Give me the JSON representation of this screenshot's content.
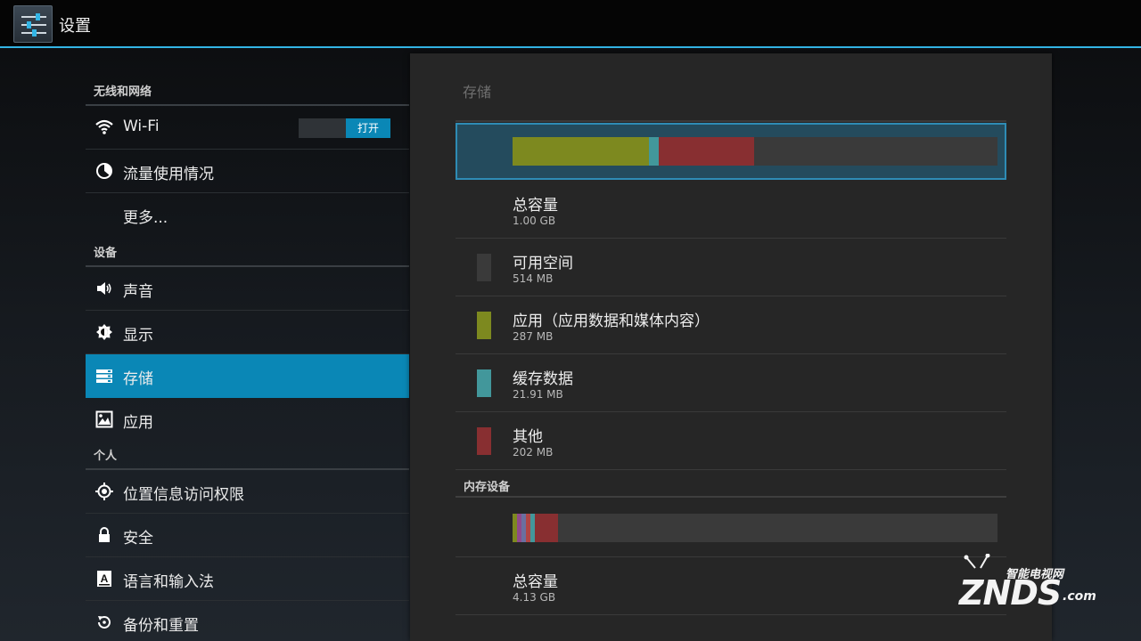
{
  "actionbar": {
    "title": "设置"
  },
  "sidebar": {
    "sections": [
      {
        "header": "无线和网络",
        "items": [
          {
            "label": "Wi-Fi",
            "icon": "wifi-icon",
            "toggle": "打开"
          },
          {
            "label": "流量使用情况",
            "icon": "data-usage-icon"
          },
          {
            "label": "更多..."
          }
        ]
      },
      {
        "header": "设备",
        "items": [
          {
            "label": "声音",
            "icon": "volume-icon"
          },
          {
            "label": "显示",
            "icon": "brightness-icon"
          },
          {
            "label": "存储",
            "icon": "storage-icon",
            "selected": true
          },
          {
            "label": "应用",
            "icon": "apps-icon"
          }
        ]
      },
      {
        "header": "个人",
        "items": [
          {
            "label": "位置信息访问权限",
            "icon": "location-icon"
          },
          {
            "label": "安全",
            "icon": "lock-icon"
          },
          {
            "label": "语言和输入法",
            "icon": "language-icon"
          },
          {
            "label": "备份和重置",
            "icon": "backup-icon"
          }
        ]
      }
    ]
  },
  "storage": {
    "title": "存储",
    "usage_bar": {
      "segments": [
        {
          "name": "应用",
          "fraction": 0.281,
          "color": "#7d891f"
        },
        {
          "name": "缓存数据",
          "fraction": 0.021,
          "color": "#42979b"
        },
        {
          "name": "其他",
          "fraction": 0.197,
          "color": "#882f31"
        }
      ],
      "track_color": "#3a3a3a"
    },
    "rows": [
      {
        "title": "总容量",
        "value": "1.00 GB",
        "color": null
      },
      {
        "title": "可用空间",
        "value": "514 MB",
        "color": "#3a3a3a"
      },
      {
        "title": "应用（应用数据和媒体内容）",
        "value": "287 MB",
        "color": "#7d891f"
      },
      {
        "title": "缓存数据",
        "value": "21.91 MB",
        "color": "#42979b"
      },
      {
        "title": "其他",
        "value": "202 MB",
        "color": "#882f31"
      }
    ],
    "internal": {
      "header": "内存设备",
      "usage_bar": {
        "segments": [
          {
            "fraction": 0.01,
            "color": "#7d891f"
          },
          {
            "fraction": 0.008,
            "color": "#8f4a8a"
          },
          {
            "fraction": 0.01,
            "color": "#6a6fa0"
          },
          {
            "fraction": 0.008,
            "color": "#b04545"
          },
          {
            "fraction": 0.01,
            "color": "#42979b"
          },
          {
            "fraction": 0.047,
            "color": "#882f31"
          }
        ]
      },
      "total_title": "总容量",
      "total_value": "4.13 GB"
    }
  },
  "watermark": {
    "brand": "ZNDS",
    "suffix": ".com",
    "cn": "智能电视网"
  }
}
